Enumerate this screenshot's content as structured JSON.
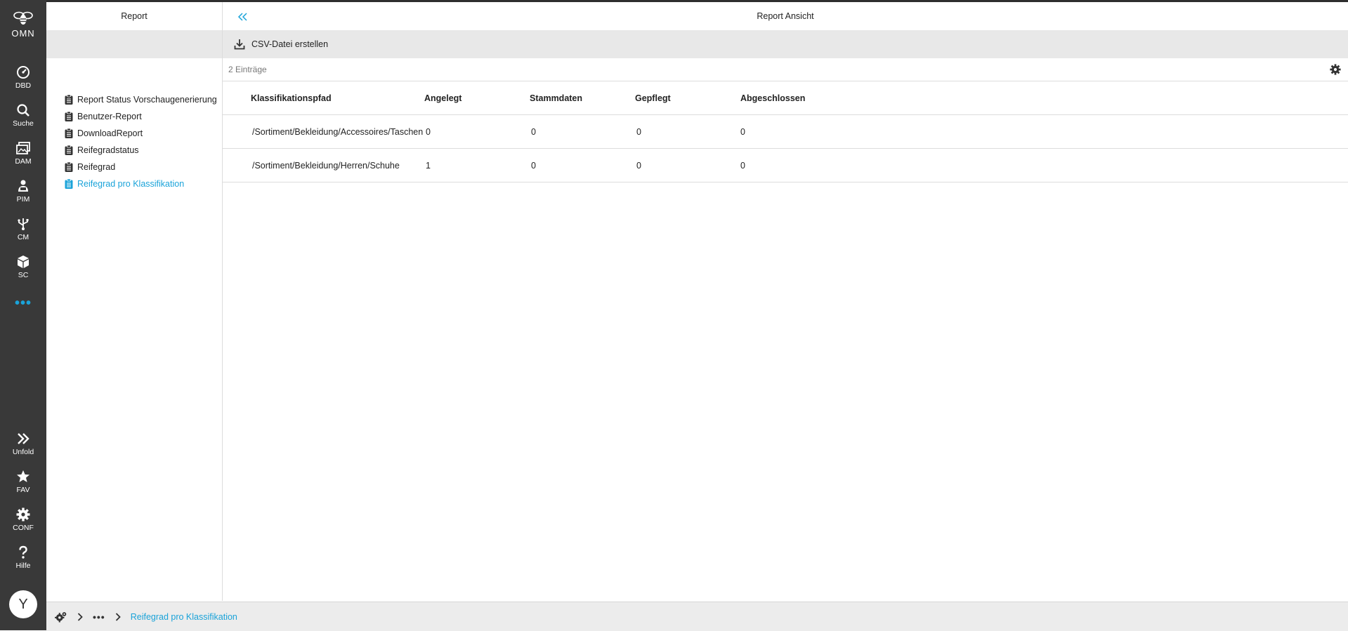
{
  "app": {
    "logo_text": "OMN",
    "colors": {
      "accent": "#1aa3d9",
      "rail": "#393939",
      "toolbar": "#e8e8e8"
    }
  },
  "rail": {
    "items": [
      {
        "label": "DBD",
        "icon": "gauge-icon"
      },
      {
        "label": "Suche",
        "icon": "search-icon"
      },
      {
        "label": "DAM",
        "icon": "image-stack-icon"
      },
      {
        "label": "PIM",
        "icon": "product-person-icon"
      },
      {
        "label": "CM",
        "icon": "usb-tree-icon"
      },
      {
        "label": "SC",
        "icon": "cube-icon"
      }
    ],
    "more_label": "•••",
    "bottom": [
      {
        "label": "Unfold",
        "icon": "double-chevron-right-icon"
      },
      {
        "label": "FAV",
        "icon": "star-icon"
      },
      {
        "label": "CONF",
        "icon": "gear-icon"
      },
      {
        "label": "Hilfe",
        "icon": "question-icon"
      }
    ],
    "avatar": "Y"
  },
  "left_panel": {
    "title": "Report",
    "items": [
      {
        "label": "Report Status Vorschaugenerierung",
        "active": false
      },
      {
        "label": "Benutzer-Report",
        "active": false
      },
      {
        "label": "DownloadReport",
        "active": false
      },
      {
        "label": "Reifegradstatus",
        "active": false
      },
      {
        "label": "Reifegrad",
        "active": false
      },
      {
        "label": "Reifegrad pro Klassifikation",
        "active": true
      }
    ]
  },
  "main": {
    "title": "Report Ansicht",
    "toolbar": {
      "csv_label": "CSV-Datei erstellen"
    },
    "count_label": "2 Einträge",
    "table": {
      "columns": [
        "Klassifikationspfad",
        "Angelegt",
        "Stammdaten",
        "Gepflegt",
        "Abgeschlossen"
      ],
      "rows": [
        [
          "/Sortiment/Bekleidung/Accessoires/Taschen",
          "0",
          "0",
          "0",
          "0"
        ],
        [
          "/Sortiment/Bekleidung/Herren/Schuhe",
          "1",
          "0",
          "0",
          "0"
        ]
      ]
    }
  },
  "footer": {
    "dots": "•••",
    "crumb": "Reifegrad pro Klassifikation"
  }
}
